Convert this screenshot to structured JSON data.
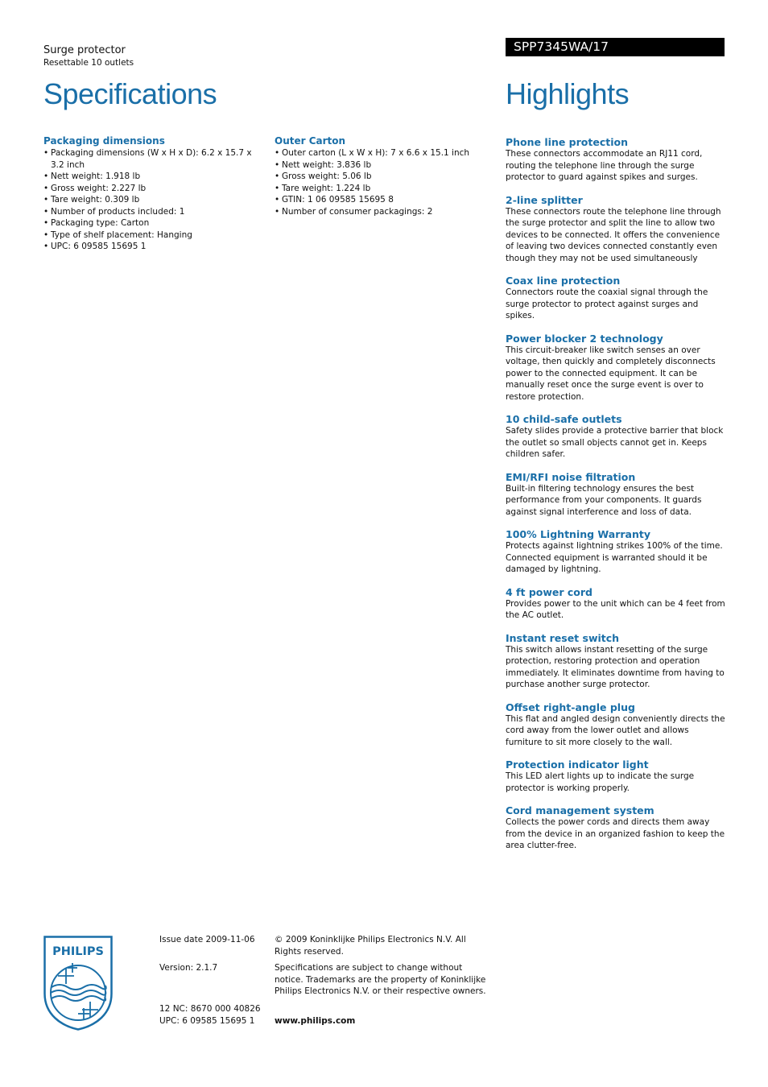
{
  "header": {
    "product_name": "Surge protector",
    "product_subtitle": "Resettable 10 outlets",
    "model": "SPP7345WA/17"
  },
  "specifications": {
    "title": "Specifications",
    "sections": [
      {
        "title": "Packaging dimensions",
        "items": [
          "Packaging dimensions (W x H x D): 6.2 x 15.7 x 3.2 inch",
          "Nett weight: 1.918 lb",
          "Gross weight: 2.227 lb",
          "Tare weight: 0.309 lb",
          "Number of products included: 1",
          "Packaging type: Carton",
          "Type of shelf placement: Hanging",
          "UPC: 6 09585 15695 1"
        ]
      },
      {
        "title": "Outer Carton",
        "items": [
          "Outer carton (L x W x H): 7 x 6.6 x 15.1 inch",
          "Nett weight: 3.836 lb",
          "Gross weight: 5.06 lb",
          "Tare weight: 1.224 lb",
          "GTIN: 1 06 09585 15695 8",
          "Number of consumer packagings: 2"
        ]
      }
    ]
  },
  "highlights": {
    "title": "Highlights",
    "items": [
      {
        "title": "Phone line protection",
        "description": "These connectors accommodate an RJ11 cord, routing the telephone line through the surge protector to guard against spikes and surges."
      },
      {
        "title": "2-line splitter",
        "description": "These connectors route the telephone line through the surge protector and split the line to allow two devices to be connected. It offers the convenience of leaving two devices connected constantly even though they may not be used simultaneously"
      },
      {
        "title": "Coax line protection",
        "description": "Connectors route the coaxial signal through the surge protector to protect against surges and spikes."
      },
      {
        "title": "Power blocker 2 technology",
        "description": "This circuit-breaker like switch senses an over voltage, then quickly and completely disconnects power to the connected equipment. It can be manually reset once the surge event is over to restore protection."
      },
      {
        "title": "10 child-safe outlets",
        "description": "Safety slides provide a protective barrier that block the outlet so small objects cannot get in. Keeps children safer."
      },
      {
        "title": "EMI/RFI noise filtration",
        "description": "Built-in filtering technology ensures the best performance from your components. It guards against signal interference and loss of data."
      },
      {
        "title": "100% Lightning Warranty",
        "description": "Protects against lightning strikes 100% of the time. Connected equipment is warranted should it be damaged by lightning."
      },
      {
        "title": "4 ft power cord",
        "description": "Provides power to the unit which can be 4 feet from the AC outlet."
      },
      {
        "title": "Instant reset switch",
        "description": "This switch allows instant resetting of the surge protection, restoring protection and operation immediately. It eliminates downtime from having to purchase another surge protector."
      },
      {
        "title": "Offset right-angle plug",
        "description": "This flat and angled design conveniently directs the cord away from the lower outlet and allows furniture to sit more closely to the wall."
      },
      {
        "title": "Protection indicator light",
        "description": "This LED alert lights up to indicate the surge protector is working properly."
      },
      {
        "title": "Cord management system",
        "description": "Collects the power cords and directs them away from the device in an organized fashion to keep the area clutter-free."
      }
    ]
  },
  "footer": {
    "logo_text": "PHILIPS",
    "issue_date": "Issue date 2009-11-06",
    "version": "Version: 2.1.7",
    "nc": "12 NC: 8670 000 40826",
    "upc": "UPC: 6 09585 15695 1",
    "copyright": "© 2009 Koninklijke Philips Electronics N.V. All Rights reserved.",
    "disclaimer": "Specifications are subject to change without notice. Trademarks are the property of Koninklijke Philips Electronics N.V. or their respective owners.",
    "website": "www.philips.com"
  },
  "colors": {
    "brand_blue": "#1a6fa8",
    "model_bar_bg": "#000000"
  }
}
